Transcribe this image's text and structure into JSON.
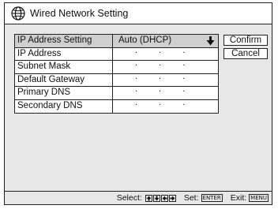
{
  "window": {
    "title": "Wired Network Setting",
    "title_icon": "globe-icon"
  },
  "form": {
    "rows": [
      {
        "label": "IP Address Setting",
        "value": "Auto (DHCP)",
        "type": "dropdown"
      },
      {
        "label": "IP Address",
        "value": ". . .",
        "type": "ip"
      },
      {
        "label": "Subnet Mask",
        "value": ". . .",
        "type": "ip"
      },
      {
        "label": "Default Gateway",
        "value": ". . .",
        "type": "ip"
      },
      {
        "label": "Primary DNS",
        "value": ". . .",
        "type": "ip"
      },
      {
        "label": "Secondary DNS",
        "value": ". . .",
        "type": "ip"
      }
    ]
  },
  "buttons": {
    "confirm": "Confirm",
    "cancel": "Cancel"
  },
  "statusbar": {
    "select_label": "Select:",
    "set_label": "Set:",
    "set_key": "ENTER",
    "exit_label": "Exit:",
    "exit_key": "MENU"
  }
}
